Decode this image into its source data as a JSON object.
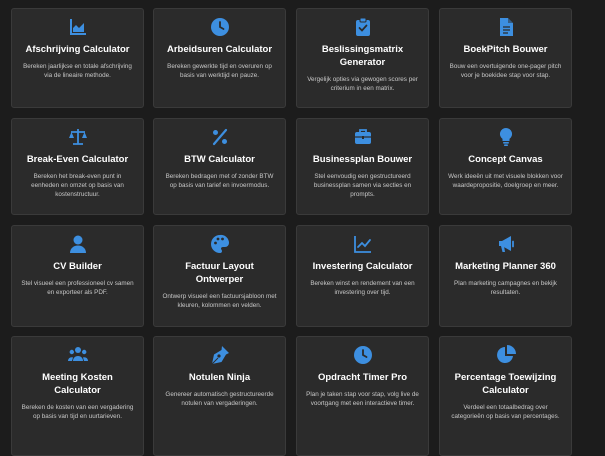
{
  "theme": {
    "background": "#1c1c1c",
    "card": "#2b2b2b",
    "accent": "#3d8fe0"
  },
  "cards": [
    {
      "icon": "area-chart-icon",
      "title": "Afschrijving Calculator",
      "desc": "Bereken jaarlijkse en totale afschrijving via de lineaire methode."
    },
    {
      "icon": "clock-icon",
      "title": "Arbeidsuren Calculator",
      "desc": "Bereken gewerkte tijd en overuren op basis van werktijd en pauze."
    },
    {
      "icon": "clipboard-check-icon",
      "title": "Beslissingsmatrix Generator",
      "desc": "Vergelijk opties via gewogen scores per criterium in een matrix."
    },
    {
      "icon": "document-icon",
      "title": "BoekPitch Bouwer",
      "desc": "Bouw een overtuigende one-pager pitch voor je boekidee stap voor stap."
    },
    {
      "icon": "scale-icon",
      "title": "Break-Even Calculator",
      "desc": "Bereken het break-even punt in eenheden en omzet op basis van kostenstructuur."
    },
    {
      "icon": "percent-icon",
      "title": "BTW Calculator",
      "desc": "Bereken bedragen met of zonder BTW op basis van tarief en invoermodus."
    },
    {
      "icon": "briefcase-icon",
      "title": "Businessplan Bouwer",
      "desc": "Stel eenvoudig een gestructureerd businessplan samen via secties en prompts."
    },
    {
      "icon": "lightbulb-icon",
      "title": "Concept Canvas",
      "desc": "Werk ideeën uit met visuele blokken voor waardepropositie, doelgroep en meer."
    },
    {
      "icon": "user-icon",
      "title": "CV Builder",
      "desc": "Stel visueel een professioneel cv samen en exporteer als PDF."
    },
    {
      "icon": "palette-icon",
      "title": "Factuur Layout Ontwerper",
      "desc": "Ontwerp visueel een factuursjabloon met kleuren, kolommen en velden."
    },
    {
      "icon": "line-chart-icon",
      "title": "Investering Calculator",
      "desc": "Bereken winst en rendement van een investering over tijd."
    },
    {
      "icon": "megaphone-icon",
      "title": "Marketing Planner 360",
      "desc": "Plan marketing campagnes en bekijk resultaten."
    },
    {
      "icon": "users-icon",
      "title": "Meeting Kosten Calculator",
      "desc": "Bereken de kosten van een vergadering op basis van tijd en uurtarieven."
    },
    {
      "icon": "pen-nib-icon",
      "title": "Notulen Ninja",
      "desc": "Genereer automatisch gestructureerde notulen van vergaderingen."
    },
    {
      "icon": "clock-icon",
      "title": "Opdracht Timer Pro",
      "desc": "Plan je taken stap voor stap, volg live de voortgang met een interactieve timer."
    },
    {
      "icon": "pie-chart-icon",
      "title": "Percentage Toewijzing Calculator",
      "desc": "Verdeel een totaalbedrag over categorieën op basis van percentages."
    }
  ]
}
